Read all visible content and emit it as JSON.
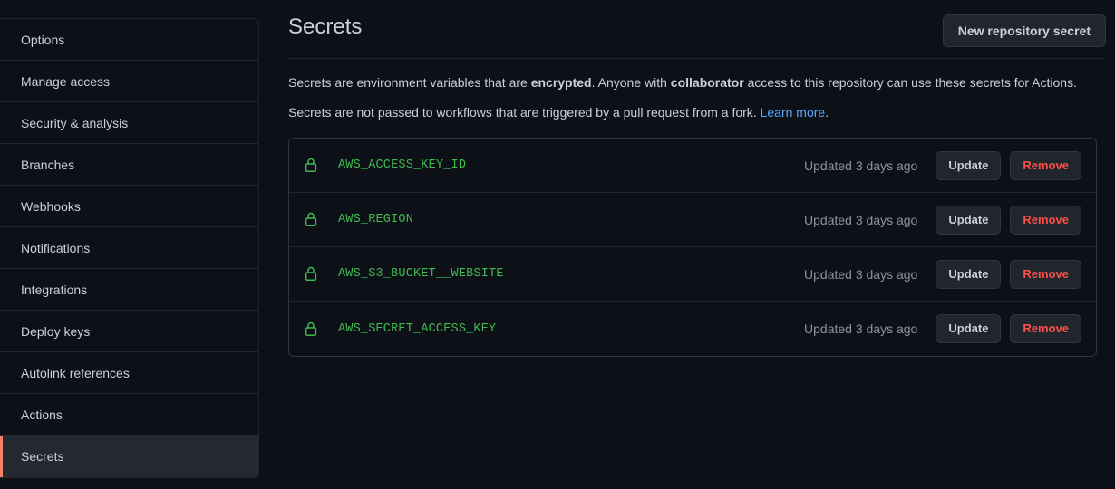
{
  "sidebar": {
    "items": [
      {
        "label": "Options",
        "selected": false
      },
      {
        "label": "Manage access",
        "selected": false
      },
      {
        "label": "Security & analysis",
        "selected": false
      },
      {
        "label": "Branches",
        "selected": false
      },
      {
        "label": "Webhooks",
        "selected": false
      },
      {
        "label": "Notifications",
        "selected": false
      },
      {
        "label": "Integrations",
        "selected": false
      },
      {
        "label": "Deploy keys",
        "selected": false
      },
      {
        "label": "Autolink references",
        "selected": false
      },
      {
        "label": "Actions",
        "selected": false
      },
      {
        "label": "Secrets",
        "selected": true
      }
    ]
  },
  "header": {
    "title": "Secrets",
    "new_secret_button": "New repository secret"
  },
  "description": {
    "line1_part1": "Secrets are environment variables that are ",
    "line1_bold1": "encrypted",
    "line1_part2": ". Anyone with ",
    "line1_bold2": "collaborator",
    "line1_part3": " access to this repository can use these secrets for Actions.",
    "line2_part1": "Secrets are not passed to workflows that are triggered by a pull request from a fork. ",
    "line2_link": "Learn more",
    "line2_part2": "."
  },
  "secrets": [
    {
      "icon": "lock-icon",
      "name": "AWS_ACCESS_KEY_ID",
      "updated": "Updated 3 days ago",
      "update_label": "Update",
      "remove_label": "Remove"
    },
    {
      "icon": "lock-icon",
      "name": "AWS_REGION",
      "updated": "Updated 3 days ago",
      "update_label": "Update",
      "remove_label": "Remove"
    },
    {
      "icon": "lock-icon",
      "name": "AWS_S3_BUCKET__WEBSITE",
      "updated": "Updated 3 days ago",
      "update_label": "Update",
      "remove_label": "Remove"
    },
    {
      "icon": "lock-icon",
      "name": "AWS_SECRET_ACCESS_KEY",
      "updated": "Updated 3 days ago",
      "update_label": "Update",
      "remove_label": "Remove"
    }
  ],
  "colors": {
    "page_bg": "#0d1117",
    "border": "#30363d",
    "text": "#c9d1d9",
    "muted": "#8b949e",
    "link": "#58a6ff",
    "secret_green": "#3fb950",
    "danger_red": "#f85149",
    "selected_accent": "#f78166",
    "selected_bg": "#24292f"
  }
}
